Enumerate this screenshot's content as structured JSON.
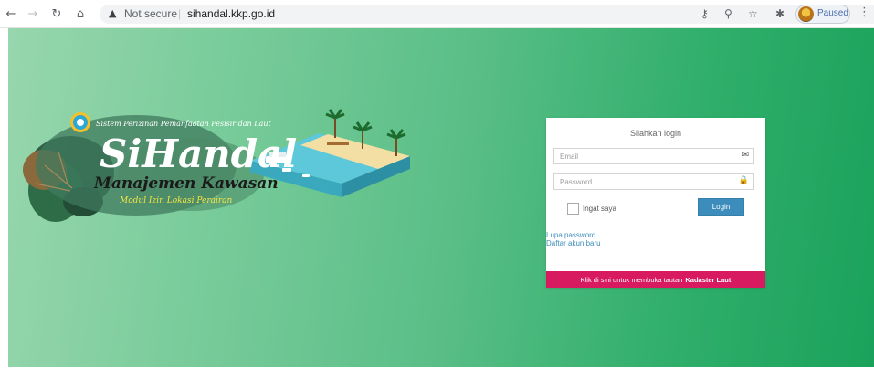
{
  "browser": {
    "back_icon": "arrow-left",
    "forward_icon": "arrow-right",
    "reload_icon": "reload",
    "home_icon": "home",
    "warning_icon": "warning-triangle",
    "security_label": "Not secure",
    "separator": "|",
    "url": "sihandal.kkp.go.id",
    "profile_status": "Paused",
    "icons": [
      "key-icon",
      "zoom-icon",
      "star-icon",
      "extensions-icon",
      "menu-icon"
    ]
  },
  "brand": {
    "tagline": "Sistem Perizinan Pemanfaatan Pesisir dan Laut",
    "logo_text": "SiHandal",
    "subtitle": "Manajemen Kawasan",
    "module": "Modul Izin Lokasi Perairan"
  },
  "login": {
    "title": "Silahkan login",
    "email_placeholder": "Email",
    "password_placeholder": "Password",
    "remember_label": "Ingat saya",
    "login_button": "Login",
    "forgot_link": "Lupa password",
    "register_link": "Daftar akun baru",
    "kadaster_text": "Klik di sini untuk membuka tautan",
    "kadaster_bold": "Kadaster Laut"
  },
  "colors": {
    "primary_button": "#3c8dbc",
    "kadaster_bar": "#d81b60",
    "background_start": "#98d6ae",
    "background_end": "#1aa25b"
  }
}
